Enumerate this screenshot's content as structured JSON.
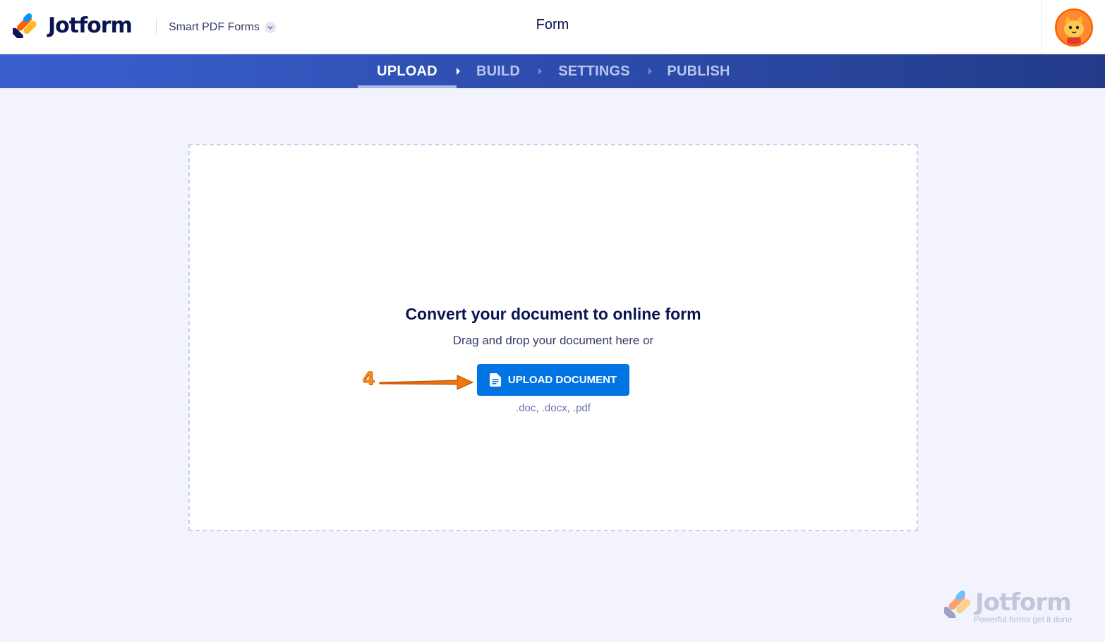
{
  "header": {
    "logo_text": "Jotform",
    "product_label": "Smart PDF Forms",
    "form_title": "Form",
    "brand_colors": [
      "#ff6100",
      "#0099ff",
      "#ffb629",
      "#0a1551"
    ]
  },
  "steps": [
    {
      "label": "UPLOAD",
      "active": true
    },
    {
      "label": "BUILD",
      "active": false
    },
    {
      "label": "SETTINGS",
      "active": false
    },
    {
      "label": "PUBLISH",
      "active": false
    }
  ],
  "dropzone": {
    "title": "Convert your document to online form",
    "subtitle": "Drag and drop your document here or",
    "button_label": "UPLOAD DOCUMENT",
    "formats": ".doc, .docx, .pdf"
  },
  "annotation": {
    "number": "4",
    "color": "#f28b1f"
  },
  "watermark": {
    "brand": "Jotform",
    "tagline": "Powerful forms get it done"
  }
}
